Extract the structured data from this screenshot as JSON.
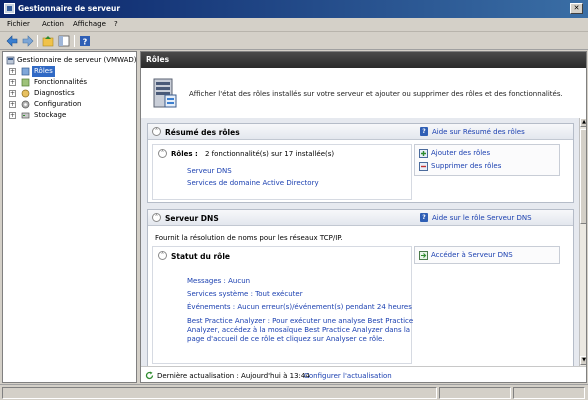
{
  "window": {
    "title": "Gestionnaire de serveur"
  },
  "menu": {
    "items": [
      "Fichier",
      "Action",
      "Affichage",
      "?"
    ]
  },
  "tree": {
    "root": "Gestionnaire de serveur (VMWAD)",
    "items": [
      {
        "label": "Rôles",
        "selected": true
      },
      {
        "label": "Fonctionnalités"
      },
      {
        "label": "Diagnostics"
      },
      {
        "label": "Configuration"
      },
      {
        "label": "Stockage"
      }
    ]
  },
  "main": {
    "header": "Rôles",
    "intro": "Afficher l'état des rôles installés sur votre serveur et ajouter ou supprimer des rôles et des fonctionnalités.",
    "summary": {
      "title": "Résumé des rôles",
      "help_link": "Aide sur Résumé des rôles",
      "roles_label": "Rôles :",
      "roles_count": "2 fonctionnalité(s) sur 17 installée(s)",
      "roles": [
        "Serveur DNS",
        "Services de domaine Active Directory"
      ],
      "actions": [
        "Ajouter des rôles",
        "Supprimer des rôles"
      ]
    },
    "dns": {
      "title": "Serveur DNS",
      "help_link": "Aide sur le rôle Serveur DNS",
      "description": "Fournit la résolution de noms pour les réseaux TCP/IP.",
      "status_title": "Statut du rôle",
      "status_action": "Accéder à Serveur DNS",
      "messages": "Messages : Aucun",
      "services": "Services système : Tout exécuter",
      "events": "Événements : Aucun erreur(s)/événement(s) pendant 24 heures",
      "bpa_line1": "Best Practice Analyzer : Pour exécuter une analyse Best Practice",
      "bpa_line2": "Analyzer, accédez à la mosaïque Best Practice Analyzer dans la",
      "bpa_line3": "page d'accueil de ce rôle et cliquez sur Analyser ce rôle."
    },
    "status": {
      "last_update": "Dernière actualisation : Aujourd'hui à 13:44",
      "configure_link": "Configurer l'actualisation"
    }
  }
}
